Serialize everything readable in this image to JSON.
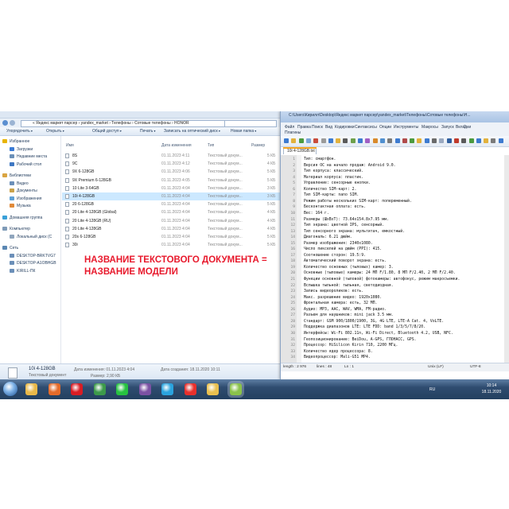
{
  "explorer": {
    "address": "« Яндекс маркет парсер › yandex_market › Телефоны › Сотовые телефоны › HONOR",
    "toolbar": [
      "Упорядочить",
      "Открыть",
      "Общий доступ",
      "Печать",
      "Записать на оптический диск",
      "Новая папка"
    ],
    "nav": [
      {
        "label": "Избранное",
        "color": "#e8b400",
        "group": true
      },
      {
        "label": "Загрузки",
        "color": "#3a7bd5"
      },
      {
        "label": "Недавние места",
        "color": "#6b8fb8"
      },
      {
        "label": "Рабочий стол",
        "color": "#3e77c2"
      },
      {
        "label": "Библиотеки",
        "color": "#d9a441",
        "group": true
      },
      {
        "label": "Видео",
        "color": "#6b8fb8"
      },
      {
        "label": "Документы",
        "color": "#c9a24a"
      },
      {
        "label": "Изображения",
        "color": "#5da0d6"
      },
      {
        "label": "Музыка",
        "color": "#e08a3a"
      },
      {
        "label": "Домашняя группа",
        "color": "#3aa0d8",
        "group": true
      },
      {
        "label": "Компьютер",
        "color": "#7f9bb8",
        "group": true
      },
      {
        "label": "Локальный диск (C",
        "color": "#8fa5bd"
      },
      {
        "label": "Сеть",
        "color": "#5b87b3",
        "group": true
      },
      {
        "label": "DESKTOP-BRKTVG7",
        "color": "#6b8fb8"
      },
      {
        "label": "DESKTOP-A1OBHGB",
        "color": "#6b8fb8"
      },
      {
        "label": "KIRILL-ПК",
        "color": "#6b8fb8"
      }
    ],
    "columns": {
      "name": "Имя",
      "date": "Дата изменения",
      "type": "Тип",
      "size": "Размер"
    },
    "files": [
      {
        "name": "8S",
        "date": "01.11.2023 4:11",
        "type": "Текстовый докум...",
        "size": "5 КБ"
      },
      {
        "name": "9C",
        "date": "01.11.2023 4:12",
        "type": "Текстовый докум...",
        "size": "4 КБ"
      },
      {
        "name": "9X 6-128GB",
        "date": "01.11.2023 4:06",
        "type": "Текстовый докум...",
        "size": "5 КБ"
      },
      {
        "name": "9X Premium 6-128GB",
        "date": "01.11.2023 4:05",
        "type": "Текстовый докум...",
        "size": "5 КБ"
      },
      {
        "name": "10 Lite 3-64GB",
        "date": "01.11.2023 4:04",
        "type": "Текстовый докум...",
        "size": "3 КБ"
      },
      {
        "name": "10i 4-128GB",
        "date": "01.11.2023 4:04",
        "type": "Текстовый докум...",
        "size": "3 КБ"
      },
      {
        "name": "20 6-128GB",
        "date": "01.11.2023 4:04",
        "type": "Текстовый докум...",
        "size": "5 КБ"
      },
      {
        "name": "20 Lite 4-128GB (Global)",
        "date": "01.11.2023 4:04",
        "type": "Текстовый докум...",
        "size": "4 КБ"
      },
      {
        "name": "20 Lite 4-128GB (RU)",
        "date": "01.11.2023 4:04",
        "type": "Текстовый докум...",
        "size": "4 КБ"
      },
      {
        "name": "20 Lite 4-128GB",
        "date": "01.11.2023 4:04",
        "type": "Текстовый докум...",
        "size": "4 КБ"
      },
      {
        "name": "20s 6-128GB",
        "date": "01.11.2023 4:04",
        "type": "Текстовый докум...",
        "size": "5 КБ"
      },
      {
        "name": "30i",
        "date": "01.11.2023 4:04",
        "type": "Текстовый докум...",
        "size": "5 КБ"
      }
    ],
    "selected_index": 5,
    "annotation": "НАЗВАНИЕ ТЕКСТОВОГО ДОКУМЕНТА = НАЗВАНИЕ МОДЕЛИ",
    "status": {
      "name": "10i 4-128GB",
      "type": "Текстовый документ",
      "modified_label": "Дата изменения: 01.11.2023 4:04",
      "size_label": "Размер: 2,90 КБ",
      "created_label": "Дата создания: 18.11.2020 10:11"
    }
  },
  "notepad": {
    "title": "C:\\Users\\Кирилл\\Desktop\\Яндекс маркет парсер\\yandex_market\\Телефоны\\Сотовые телефоны\\H...",
    "menu": [
      "Файл",
      "Правка",
      "Поиск",
      "Вид",
      "Кодировки",
      "Синтаксисы",
      "Опции",
      "Инструменты",
      "Макросы",
      "Запуск",
      "Плагины",
      "Вкладки",
      "?"
    ],
    "tab": "10i 4-128GB.txt",
    "lines": [
      "Тип: смартфон.",
      "Версия ОС на начало продаж: Android 9.0.",
      "Тип корпуса: классический.",
      "Материал корпуса: пластик.",
      "Управление: сенсорные кнопки.",
      "Количество SIM-карт: 2.",
      "Тип SIM-карты: nano SIM.",
      "Режим работы нескольких SIM-карт: попеременный.",
      "Бесконтактная оплата: есть.",
      "Вес: 164 г.",
      "Размеры (ШxВxТ): 73.64x154.8x7.95 мм.",
      "Тип экрана: цветной IPS, сенсорный.",
      "Тип сенсорного экрана: мультитач, емкостный.",
      "Диагональ: 6.21 дюйм.",
      "Размер изображения: 2340x1080.",
      "Число пикселей на дюйм (PPI): 415.",
      "Соотношение сторон: 19.5:9.",
      "Автоматический поворот экрана: есть.",
      "Количество основных (тыловых) камер: 3.",
      "Основные (тыловые) камеры: 24 МП F/1.80, 8 МП F/2.40, 2 МП F/2.40.",
      "Функции основной (тыловой) фотокамеры: автофокус, режим макросъемки.",
      "Вспышка тыльной: тыльная, светодиодная.",
      "Запись видеороликов: есть.",
      "Макс. разрешение видео: 1920x1080.",
      "Фронтальная камера: есть, 32 МП.",
      "Аудио: MP3, AAC, WAV, WMA, FM-радио.",
      "Разъем для наушников: mini jack 3.5 мм.",
      "Стандарт: GSM 900/1800/1900, 3G, 4G LTE, LTE-A Cat. 4, VoLTE.",
      "Поддержка диапазонов LTE: LTE FDD: band 1/3/5/7/8/20.",
      "Интерфейсы: Wi-Fi 802.11n, Wi-Fi Direct, Bluetooth 4.2, USB, NFC.",
      "Геопозиционирование: BeiDou, A-GPS, ГЛОНАСС, GPS.",
      "Процессор: HiSilicon Kirin 710, 2200 МГц.",
      "Количество ядер процессора: 8.",
      "Видеопроцессор: Mali-G51 MP4."
    ],
    "status": {
      "length": "length : 2 976",
      "lines": "lines : 48",
      "ln": "Ln : 1",
      "eol": "Unix (LF)",
      "enc": "UTF-8"
    }
  },
  "taskbar": {
    "apps": [
      {
        "name": "explorer-app",
        "color": "#e9b949"
      },
      {
        "name": "media-player-app",
        "color": "#e46b2a"
      },
      {
        "name": "opera-app",
        "color": "#d81c24"
      },
      {
        "name": "chrome-app",
        "color": "#3c9a4a"
      },
      {
        "name": "whatsapp-app",
        "color": "#27c241"
      },
      {
        "name": "viber-app",
        "color": "#7b51a3"
      },
      {
        "name": "telegram-app",
        "color": "#2aa3de"
      },
      {
        "name": "yandex-browser-app",
        "color": "#e8302c"
      },
      {
        "name": "file-manager-app",
        "color": "#e9c04f"
      },
      {
        "name": "notepadpp-app",
        "color": "#8ac24a"
      }
    ],
    "lang": "RU",
    "time": "10:14",
    "date": "18.11.2020"
  }
}
